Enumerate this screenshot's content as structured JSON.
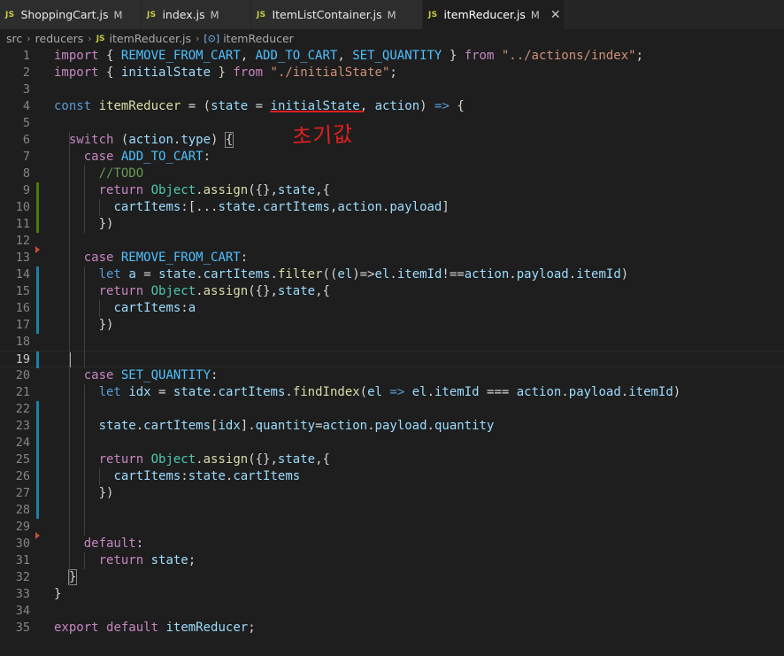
{
  "tabs": [
    {
      "badge": "JS",
      "name": "ShoppingCart.js",
      "status": "M",
      "active": false
    },
    {
      "badge": "JS",
      "name": "index.js",
      "status": "M",
      "active": false
    },
    {
      "badge": "JS",
      "name": "ItemListContainer.js",
      "status": "M",
      "active": false
    },
    {
      "badge": "JS",
      "name": "itemReducer.js",
      "status": "M",
      "active": true,
      "close": "✕"
    }
  ],
  "breadcrumb": {
    "items": [
      "src",
      "reducers",
      "itemReducer.js",
      "itemReducer"
    ],
    "file_badge": "JS",
    "symbol_icon": "[⊙]",
    "separator": "›"
  },
  "annotation": "초기값",
  "line_numbers": [
    "1",
    "2",
    "3",
    "4",
    "5",
    "6",
    "7",
    "8",
    "9",
    "10",
    "11",
    "12",
    "13",
    "14",
    "15",
    "16",
    "17",
    "18",
    "19",
    "20",
    "21",
    "22",
    "23",
    "24",
    "25",
    "26",
    "27",
    "28",
    "29",
    "30",
    "31",
    "32",
    "33",
    "34",
    "35"
  ],
  "code_lines": [
    "import { REMOVE_FROM_CART, ADD_TO_CART, SET_QUANTITY } from \"../actions/index\";",
    "import { initialState } from \"./initialState\";",
    "",
    "const itemReducer = (state = initialState, action) => {",
    "",
    "  switch (action.type) {",
    "    case ADD_TO_CART:",
    "      //TODO",
    "      return Object.assign({},state,{",
    "        cartItems:[...state.cartItems,action.payload]",
    "      })",
    "",
    "    case REMOVE_FROM_CART:",
    "      let a = state.cartItems.filter((el)=>el.itemId!==action.payload.itemId)",
    "      return Object.assign({},state,{",
    "        cartItems:a",
    "      })",
    "",
    "",
    "    case SET_QUANTITY:",
    "      let idx = state.cartItems.findIndex(el => el.itemId === action.payload.itemId)",
    "",
    "      state.cartItems[idx].quantity=action.payload.quantity",
    "",
    "      return Object.assign({},state,{",
    "        cartItems:state.cartItems",
    "      })",
    "",
    "",
    "    default:",
    "      return state;",
    "  }",
    "}",
    "",
    "export default itemReducer;"
  ],
  "gutter_markers": {
    "9": "add",
    "10": "add",
    "11": "add",
    "12": "del",
    "14": "mod",
    "15": "mod",
    "16": "mod",
    "17": "mod",
    "19": "mod",
    "22": "mod",
    "23": "mod",
    "24": "mod",
    "25": "mod",
    "26": "mod",
    "27": "mod",
    "28": "mod",
    "29": "del"
  },
  "current_line": 19,
  "colors": {
    "background": "#1e1e1e",
    "keyword": "#c586c0",
    "storage": "#569cd6",
    "variable": "#9cdcfe",
    "constant": "#4fc1ff",
    "function": "#dcdcaa",
    "class": "#4ec9b0",
    "string": "#ce9178",
    "comment": "#6a9955",
    "gutter_modified": "#1b81a8",
    "gutter_added": "#487e02",
    "gutter_deleted": "#c74e39",
    "annotation": "#e02020"
  },
  "icons": {
    "js_file": "js-file-icon",
    "close": "close-icon",
    "chevron": "chevron-right-icon",
    "symbol": "symbol-variable-icon"
  }
}
